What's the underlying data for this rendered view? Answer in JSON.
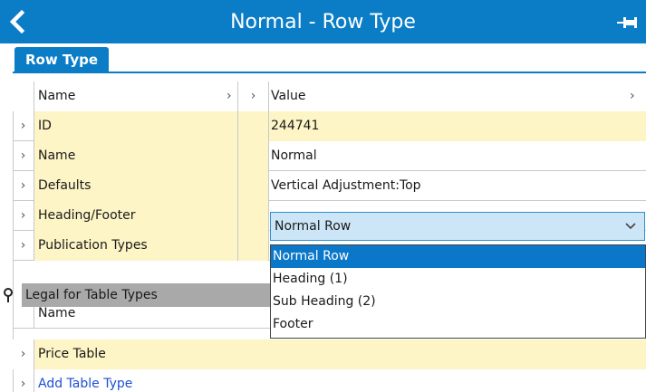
{
  "window": {
    "title": "Normal - Row Type",
    "back_icon": "chevron-left-icon",
    "pin_icon": "pin-icon"
  },
  "tabs": [
    {
      "label": "Row Type",
      "active": true
    }
  ],
  "header": {
    "name": "Name",
    "value": "Value",
    "arrow_right": "›",
    "collapse": "›"
  },
  "properties": [
    {
      "label": "ID",
      "value": "244741",
      "arrow": "›"
    },
    {
      "label": "Name",
      "value": "Normal",
      "arrow": "›"
    },
    {
      "label": "Defaults",
      "value": "Vertical Adjustment:Top",
      "arrow": "›"
    },
    {
      "label": "Heading/Footer",
      "value": "Normal Row",
      "arrow": "›"
    },
    {
      "label": "Publication Types",
      "value": "",
      "arrow": "›"
    }
  ],
  "dropdown": {
    "selected": "Normal Row",
    "options": [
      "Normal Row",
      "Heading (1)",
      "Sub Heading (2)",
      "Footer"
    ]
  },
  "legal": {
    "title": "Legal for Table Types",
    "column": "Name",
    "rows": [
      {
        "label": "Price Table",
        "arrow": "›"
      }
    ],
    "add_link": "Add Table Type",
    "add_arrow": "›"
  },
  "colors": {
    "accent": "#0a7dc6",
    "row_highlight": "#fdf5c6",
    "selected_option": "#0a77c9",
    "dropdown_field": "#cde6f7",
    "link": "#1f4fd6"
  }
}
